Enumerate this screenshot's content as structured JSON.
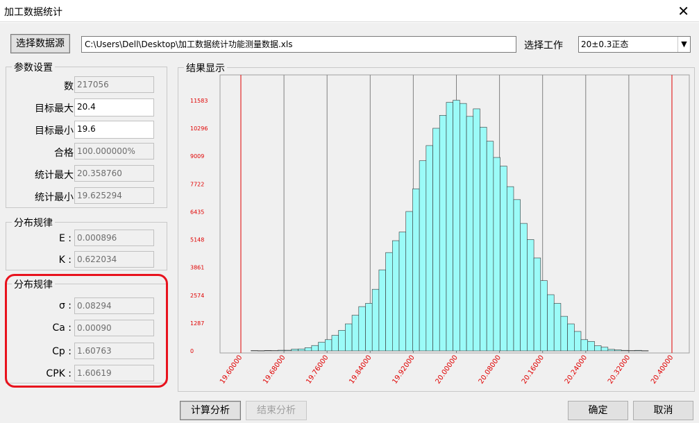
{
  "window": {
    "title": "加工数据统计",
    "close_glyph": "✕"
  },
  "source": {
    "button_label": "选择数据源",
    "path": "C:\\Users\\Dell\\Desktop\\加工数据统计功能测量数据.xls"
  },
  "work": {
    "label": "选择工作",
    "selected": "20±0.3正态"
  },
  "params": {
    "group_title": "参数设置",
    "count_label": "数",
    "count_value": "217056",
    "target_max_label": "目标最大",
    "target_max_value": "20.4",
    "target_min_label": "目标最小",
    "target_min_value": "19.6",
    "pass_label": "合格",
    "pass_value": "100.000000%",
    "stat_max_label": "统计最大",
    "stat_max_value": "20.358760",
    "stat_min_label": "统计最小",
    "stat_min_value": "19.625294"
  },
  "dist1": {
    "group_title": "分布规律",
    "e_label": "E :",
    "e_value": "0.000896",
    "k_label": "K :",
    "k_value": "0.622034"
  },
  "dist2": {
    "group_title": "分布规律",
    "sigma_label": "σ :",
    "sigma_value": "0.08294",
    "ca_label": "Ca :",
    "ca_value": "0.00090",
    "cp_label": "Cp :",
    "cp_value": "1.60763",
    "cpk_label": "CPK :",
    "cpk_value": "1.60619"
  },
  "result": {
    "group_title": "结果显示"
  },
  "buttons": {
    "calc": "计算分析",
    "stop": "结束分析",
    "ok": "确定",
    "cancel": "取消"
  },
  "colors": {
    "bar_fill": "#9bfbf8",
    "bar_stroke": "#333333",
    "axis_label": "#e00000",
    "limit_line": "#e00000",
    "grid": "#808080",
    "plot_bg": "#f0f0f0",
    "highlight": "#e8121d"
  },
  "chart_data": {
    "type": "bar",
    "ylim": [
      0,
      11583
    ],
    "yticks": [
      "0",
      "1287",
      "2574",
      "3861",
      "5148",
      "6435",
      "7722",
      "9009",
      "10296",
      "11583"
    ],
    "xlim": [
      19.6,
      20.4
    ],
    "xticks": [
      "19.60000",
      "19.68000",
      "19.76000",
      "19.84000",
      "19.92000",
      "20.00000",
      "20.08000",
      "20.16000",
      "20.24000",
      "20.32000",
      "20.40000"
    ],
    "limits": [
      19.6,
      20.4
    ],
    "bin_width": 0.0125,
    "bins": [
      {
        "x": 19.625,
        "y": 15
      },
      {
        "x": 19.6375,
        "y": 10
      },
      {
        "x": 19.65,
        "y": 20
      },
      {
        "x": 19.6625,
        "y": 15
      },
      {
        "x": 19.675,
        "y": 30
      },
      {
        "x": 19.6875,
        "y": 30
      },
      {
        "x": 19.7,
        "y": 80
      },
      {
        "x": 19.7125,
        "y": 90
      },
      {
        "x": 19.725,
        "y": 150
      },
      {
        "x": 19.7375,
        "y": 250
      },
      {
        "x": 19.75,
        "y": 400
      },
      {
        "x": 19.7625,
        "y": 520
      },
      {
        "x": 19.775,
        "y": 720
      },
      {
        "x": 19.7875,
        "y": 950
      },
      {
        "x": 19.8,
        "y": 1250
      },
      {
        "x": 19.8125,
        "y": 1650
      },
      {
        "x": 19.825,
        "y": 2050
      },
      {
        "x": 19.8375,
        "y": 2200
      },
      {
        "x": 19.85,
        "y": 2850
      },
      {
        "x": 19.8625,
        "y": 3750
      },
      {
        "x": 19.875,
        "y": 4550
      },
      {
        "x": 19.8875,
        "y": 5100
      },
      {
        "x": 19.9,
        "y": 5500
      },
      {
        "x": 19.9125,
        "y": 6450
      },
      {
        "x": 19.925,
        "y": 7500
      },
      {
        "x": 19.9375,
        "y": 8800
      },
      {
        "x": 19.95,
        "y": 9500
      },
      {
        "x": 19.9625,
        "y": 10300
      },
      {
        "x": 19.975,
        "y": 10900
      },
      {
        "x": 19.9875,
        "y": 11500
      },
      {
        "x": 20.0,
        "y": 11600
      },
      {
        "x": 20.0125,
        "y": 11450
      },
      {
        "x": 20.025,
        "y": 10850
      },
      {
        "x": 20.0375,
        "y": 11200
      },
      {
        "x": 20.05,
        "y": 10350
      },
      {
        "x": 20.0625,
        "y": 9700
      },
      {
        "x": 20.075,
        "y": 8950
      },
      {
        "x": 20.0875,
        "y": 8550
      },
      {
        "x": 20.1,
        "y": 7600
      },
      {
        "x": 20.1125,
        "y": 7000
      },
      {
        "x": 20.125,
        "y": 5900
      },
      {
        "x": 20.1375,
        "y": 5150
      },
      {
        "x": 20.15,
        "y": 4300
      },
      {
        "x": 20.1625,
        "y": 3250
      },
      {
        "x": 20.175,
        "y": 2600
      },
      {
        "x": 20.1875,
        "y": 2200
      },
      {
        "x": 20.2,
        "y": 1600
      },
      {
        "x": 20.2125,
        "y": 1250
      },
      {
        "x": 20.225,
        "y": 900
      },
      {
        "x": 20.2375,
        "y": 520
      },
      {
        "x": 20.25,
        "y": 440
      },
      {
        "x": 20.2625,
        "y": 240
      },
      {
        "x": 20.275,
        "y": 170
      },
      {
        "x": 20.2875,
        "y": 70
      },
      {
        "x": 20.3,
        "y": 45
      },
      {
        "x": 20.3125,
        "y": 25
      },
      {
        "x": 20.325,
        "y": 15
      },
      {
        "x": 20.3375,
        "y": 25
      },
      {
        "x": 20.35,
        "y": 10
      }
    ]
  }
}
